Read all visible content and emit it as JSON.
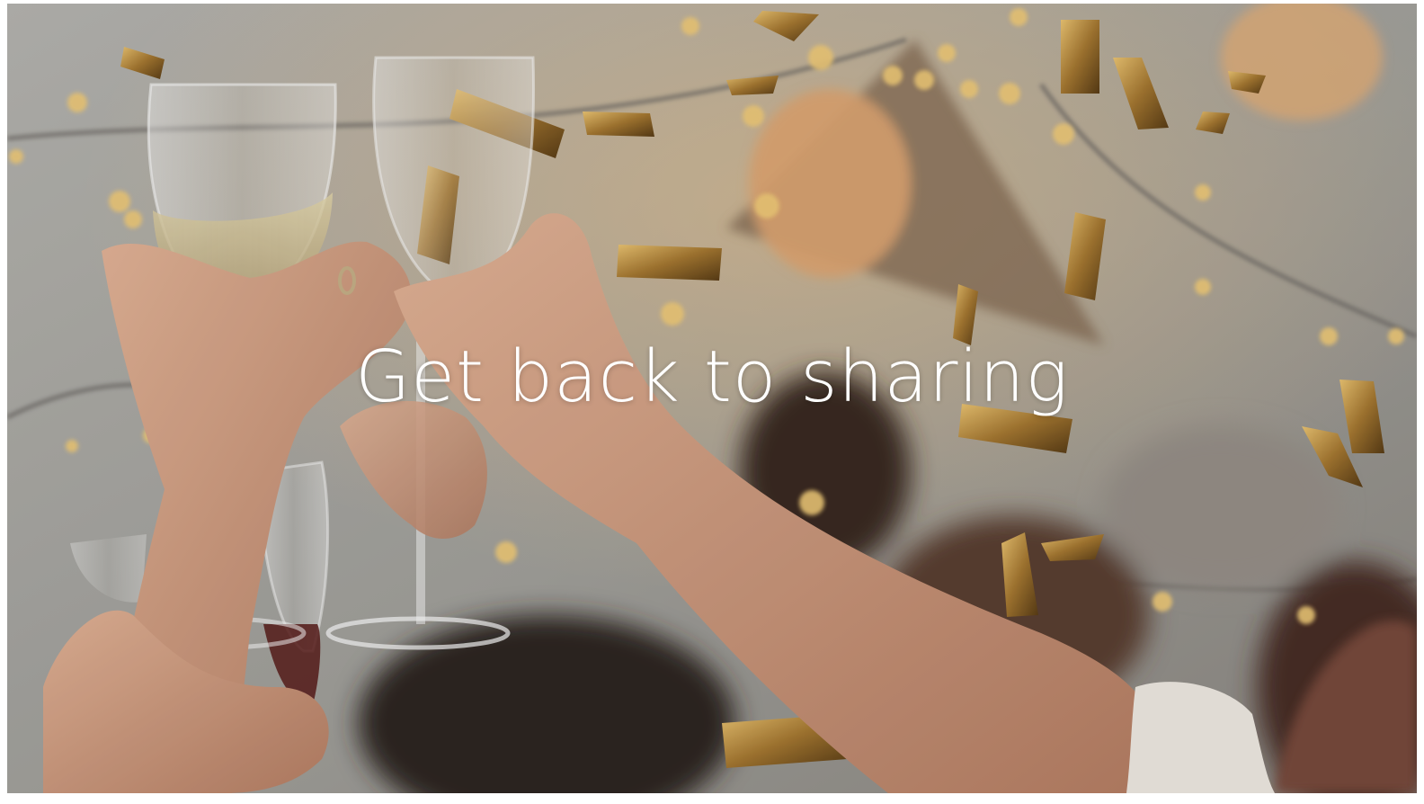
{
  "hero": {
    "headline": "Get back to sharing",
    "image": {
      "alt": "",
      "subject": "raised-glasses-toast-with-confetti",
      "colors": {
        "wall": "#a9a9a5",
        "skin": "#d8a98a",
        "gold": "#c9953e",
        "bokeh": "#f5cf7a"
      }
    }
  }
}
